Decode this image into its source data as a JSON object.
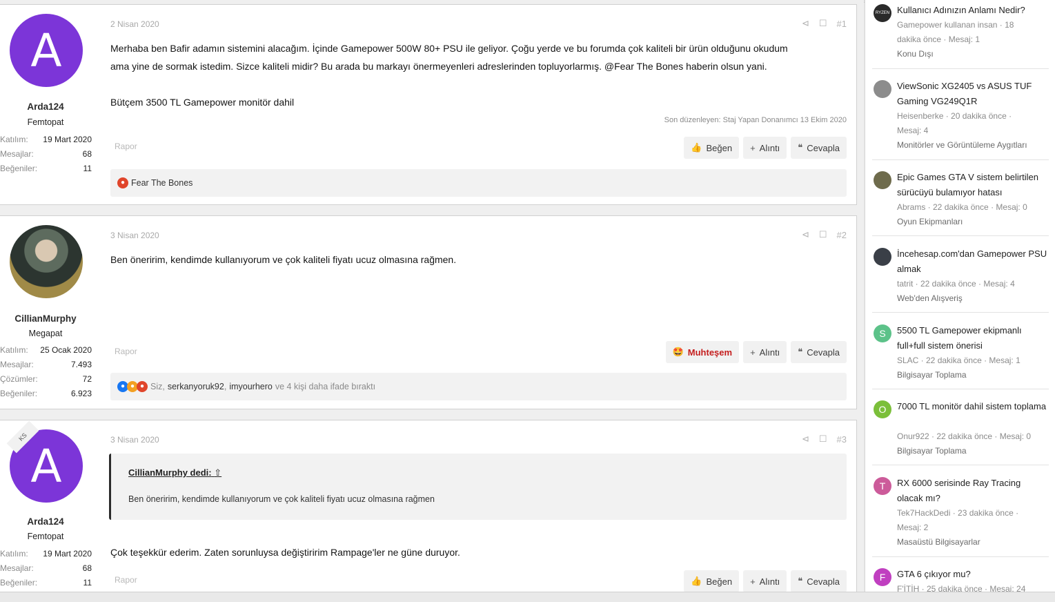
{
  "posts": [
    {
      "user": {
        "name": "Arda124",
        "title": "Femtopat",
        "avatar_letter": "A",
        "stats": [
          {
            "k": "Katılım:",
            "v": "19 Mart 2020"
          },
          {
            "k": "Mesajlar:",
            "v": "68"
          },
          {
            "k": "Beğeniler:",
            "v": "11"
          }
        ]
      },
      "date": "2 Nisan 2020",
      "number": "#1",
      "lines": [
        "Merhaba ben Bafir adamın sistemini alacağım. İçinde Gamepower 500W 80+ PSU ile geliyor. Çoğu yerde ve bu forumda çok kaliteli bir ürün olduğunu okudum",
        "ama yine de sormak istedim. Sizce kaliteli midir? Bu arada bu markayı önermeyenleri adreslerinden topluyorlarmış. @Fear The Bones haberin olsun yani.",
        "",
        "Bütçem 3500 TL Gamepower monitör dahil"
      ],
      "edited": "Son düzenleyen: Staj Yapan Donanımcı 13 Ekim 2020",
      "report": "Rapor",
      "actions": {
        "like": "Beğen",
        "quote": "Alıntı",
        "reply": "Cevapla"
      },
      "reactions": {
        "names": "Fear The Bones"
      }
    },
    {
      "user": {
        "name": "CillianMurphy",
        "title": "Megapat",
        "stats": [
          {
            "k": "Katılım:",
            "v": "25 Ocak 2020"
          },
          {
            "k": "Mesajlar:",
            "v": "7.493"
          },
          {
            "k": "Çözümler:",
            "v": "72"
          },
          {
            "k": "Beğeniler:",
            "v": "6.923"
          }
        ]
      },
      "date": "3 Nisan 2020",
      "number": "#2",
      "lines": [
        "Ben öneririm, kendimde kullanıyorum ve çok kaliteli fiyatı ucuz olmasına rağmen."
      ],
      "report": "Rapor",
      "actions": {
        "like": "Muhteşem",
        "quote": "Alıntı",
        "reply": "Cevapla"
      },
      "reactions": {
        "prefix": "Siz,",
        "name1": "serkanyoruk92",
        "sep": ",",
        "name2": "imyourhero",
        "suffix": "ve 4 kişi daha ifade bıraktı"
      }
    },
    {
      "user": {
        "name": "Arda124",
        "title": "Femtopat",
        "avatar_letter": "A",
        "ribbon": "KS",
        "stats": [
          {
            "k": "Katılım:",
            "v": "19 Mart 2020"
          },
          {
            "k": "Mesajlar:",
            "v": "68"
          },
          {
            "k": "Beğeniler:",
            "v": "11"
          }
        ]
      },
      "date": "3 Nisan 2020",
      "number": "#3",
      "quote": {
        "head": "CillianMurphy dedi:",
        "body": "Ben öneririm, kendimde kullanıyorum ve çok kaliteli fiyatı ucuz olmasına rağmen"
      },
      "lines": [
        "Çok teşekkür ederim. Zaten sorunluysa değiştiririm Rampage'ler ne güne duruyor."
      ],
      "report": "Rapor",
      "actions": {
        "like": "Beğen",
        "quote": "Alıntı",
        "reply": "Cevapla"
      }
    }
  ],
  "sidebar": {
    "threads": [
      {
        "title": "Kullanıcı Adınızın Anlamı Nedir?",
        "meta1": "Gamepower kullanan insan · 18",
        "meta2": "dakika önce · Mesaj: 1",
        "forum": "Konu Dışı",
        "avatar": "RYZEN",
        "color": "#2a2a2a"
      },
      {
        "title": "ViewSonic XG2405 vs ASUS TUF Gaming VG249Q1R",
        "meta1": "Heisenberke · 20 dakika önce ·",
        "meta2": "Mesaj: 4",
        "forum": "Monitörler ve Görüntüleme Aygıtları",
        "avatar": "",
        "color": "#8c8c8c"
      },
      {
        "title": "Epic Games GTA V sistem belirtilen sürücüyü bulamıyor hatası",
        "meta1": "Abrams · 22 dakika önce · Mesaj: 0",
        "meta2": "",
        "forum": "Oyun Ekipmanları",
        "avatar": "",
        "color": "#6e6b4c"
      },
      {
        "title": "İncehesap.com'dan Gamepower PSU almak",
        "meta1": "tatrit · 22 dakika önce · Mesaj: 4",
        "meta2": "",
        "forum": "Web'den Alışveriş",
        "avatar": "",
        "color": "#3a3f47"
      },
      {
        "title": "5500 TL Gamepower ekipmanlı full+full sistem önerisi",
        "meta1": "SLAC · 22 dakika önce · Mesaj: 1",
        "meta2": "",
        "forum": "Bilgisayar Toplama",
        "avatar": "S",
        "color": "#5cc289"
      },
      {
        "title": "7000 TL monitör dahil sistem toplama",
        "meta1": "Onur922 · 22 dakika önce · Mesaj: 0",
        "meta2": "",
        "forum": "Bilgisayar Toplama",
        "avatar": "O",
        "color": "#7bbf3a"
      },
      {
        "title": "RX 6000 serisinde Ray Tracing olacak mı?",
        "meta1": "Tek7HackDedi · 23 dakika önce ·",
        "meta2": "Mesaj: 2",
        "forum": "Masaüstü Bilgisayarlar",
        "avatar": "T",
        "color": "#cc5b9a"
      },
      {
        "title": "GTA 6 çıkıyor mu?",
        "meta1": "F'İTİH · 25 dakika önce · Mesaj: 24",
        "meta2": "",
        "forum": "",
        "avatar": "F",
        "color": "#c03fc0"
      }
    ]
  }
}
